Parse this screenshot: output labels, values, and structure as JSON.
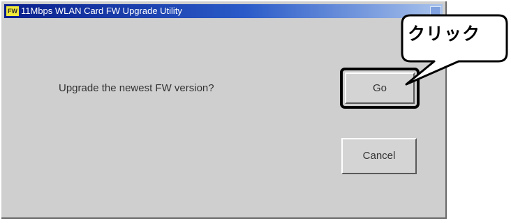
{
  "window": {
    "icon_label": "FW",
    "title": "11Mbps WLAN Card FW Upgrade Utility"
  },
  "dialog": {
    "message": "Upgrade the newest FW version?",
    "go_label": "Go",
    "cancel_label": "Cancel"
  },
  "callout": {
    "text": "クリック"
  },
  "colors": {
    "dialog_bg": "#cfcfcf",
    "titlebar_start": "#0a1f8c",
    "titlebar_end": "#a9c3ec",
    "icon_bg": "#f2ea3a",
    "highlight": "#000000"
  }
}
